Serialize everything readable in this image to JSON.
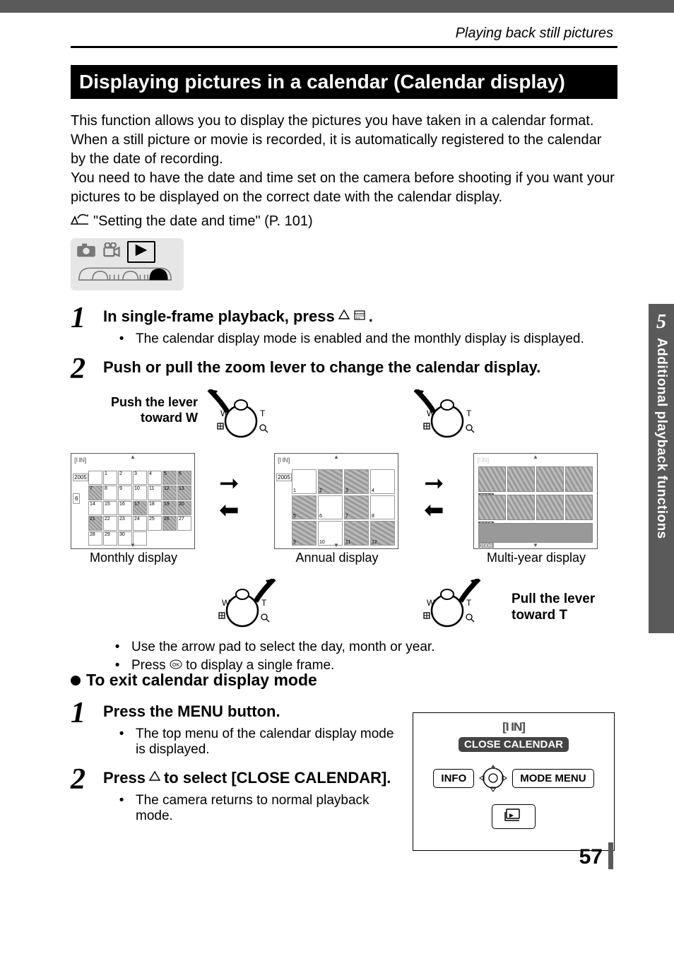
{
  "header": {
    "running_head": "Playing back still pictures"
  },
  "section_title": "Displaying pictures in a calendar (Calendar display)",
  "intro_text": "This function allows you to display the pictures you have taken in a calendar format. When a still picture or movie is recorded, it is automatically registered to the calendar by the date of recording.\nYou need to have the date and time set on the camera before shooting if you want your pictures to be displayed on the correct date with the calendar display.",
  "ref_text": "\"Setting the date and time\" (P. 101)",
  "step1": {
    "heading_a": "In single-frame playback, press ",
    "heading_b": ".",
    "bullet": "The calendar display mode is enabled and the monthly display is displayed."
  },
  "step2": {
    "heading": "Push or pull the zoom lever to change the calendar display.",
    "push_label": "Push the lever toward W",
    "pull_label": "Pull the lever toward T",
    "captions": {
      "monthly": "Monthly display",
      "annual": "Annual display",
      "multiyear": "Multi-year display"
    },
    "bullets": [
      "Use the arrow pad to select the day, month or year.",
      "Press    to display a single frame."
    ],
    "ok_aside": "OK"
  },
  "subheading": "To exit calendar display mode",
  "exit_step1": {
    "heading": "Press the MENU button.",
    "bullet": "The top menu of the calendar display mode is displayed."
  },
  "exit_step2": {
    "heading_a": "Press ",
    "heading_b": " to select [CLOSE CALENDAR].",
    "bullet": "The camera returns to normal playback mode."
  },
  "menu_screen": {
    "brand": "[I IN]",
    "close": "CLOSE CALENDAR",
    "info": "INFO",
    "mode_menu": "MODE MENU"
  },
  "side_tab": {
    "num": "5",
    "label": "Additional playback functions"
  },
  "page_number": "57",
  "brand_strip": "[I IN]",
  "monthly": {
    "year": "2005",
    "month": "6",
    "days": [
      "",
      "1",
      "2",
      "3",
      "4",
      "5",
      "6",
      "7",
      "8",
      "9",
      "10",
      "11",
      "12",
      "13",
      "14",
      "15",
      "16",
      "17",
      "18",
      "19",
      "20",
      "21",
      "22",
      "23",
      "24",
      "25",
      "26",
      "27",
      "28",
      "29",
      "30",
      ""
    ]
  },
  "annual": {
    "year": "2005",
    "months": [
      "1",
      "2",
      "3",
      "4",
      "5",
      "6",
      "7",
      "8",
      "9",
      "10",
      "11",
      "12"
    ]
  },
  "multiyear": {
    "years": [
      "2004",
      "2005",
      "2006"
    ]
  },
  "zoom_labels": {
    "w": "W",
    "t": "T"
  }
}
